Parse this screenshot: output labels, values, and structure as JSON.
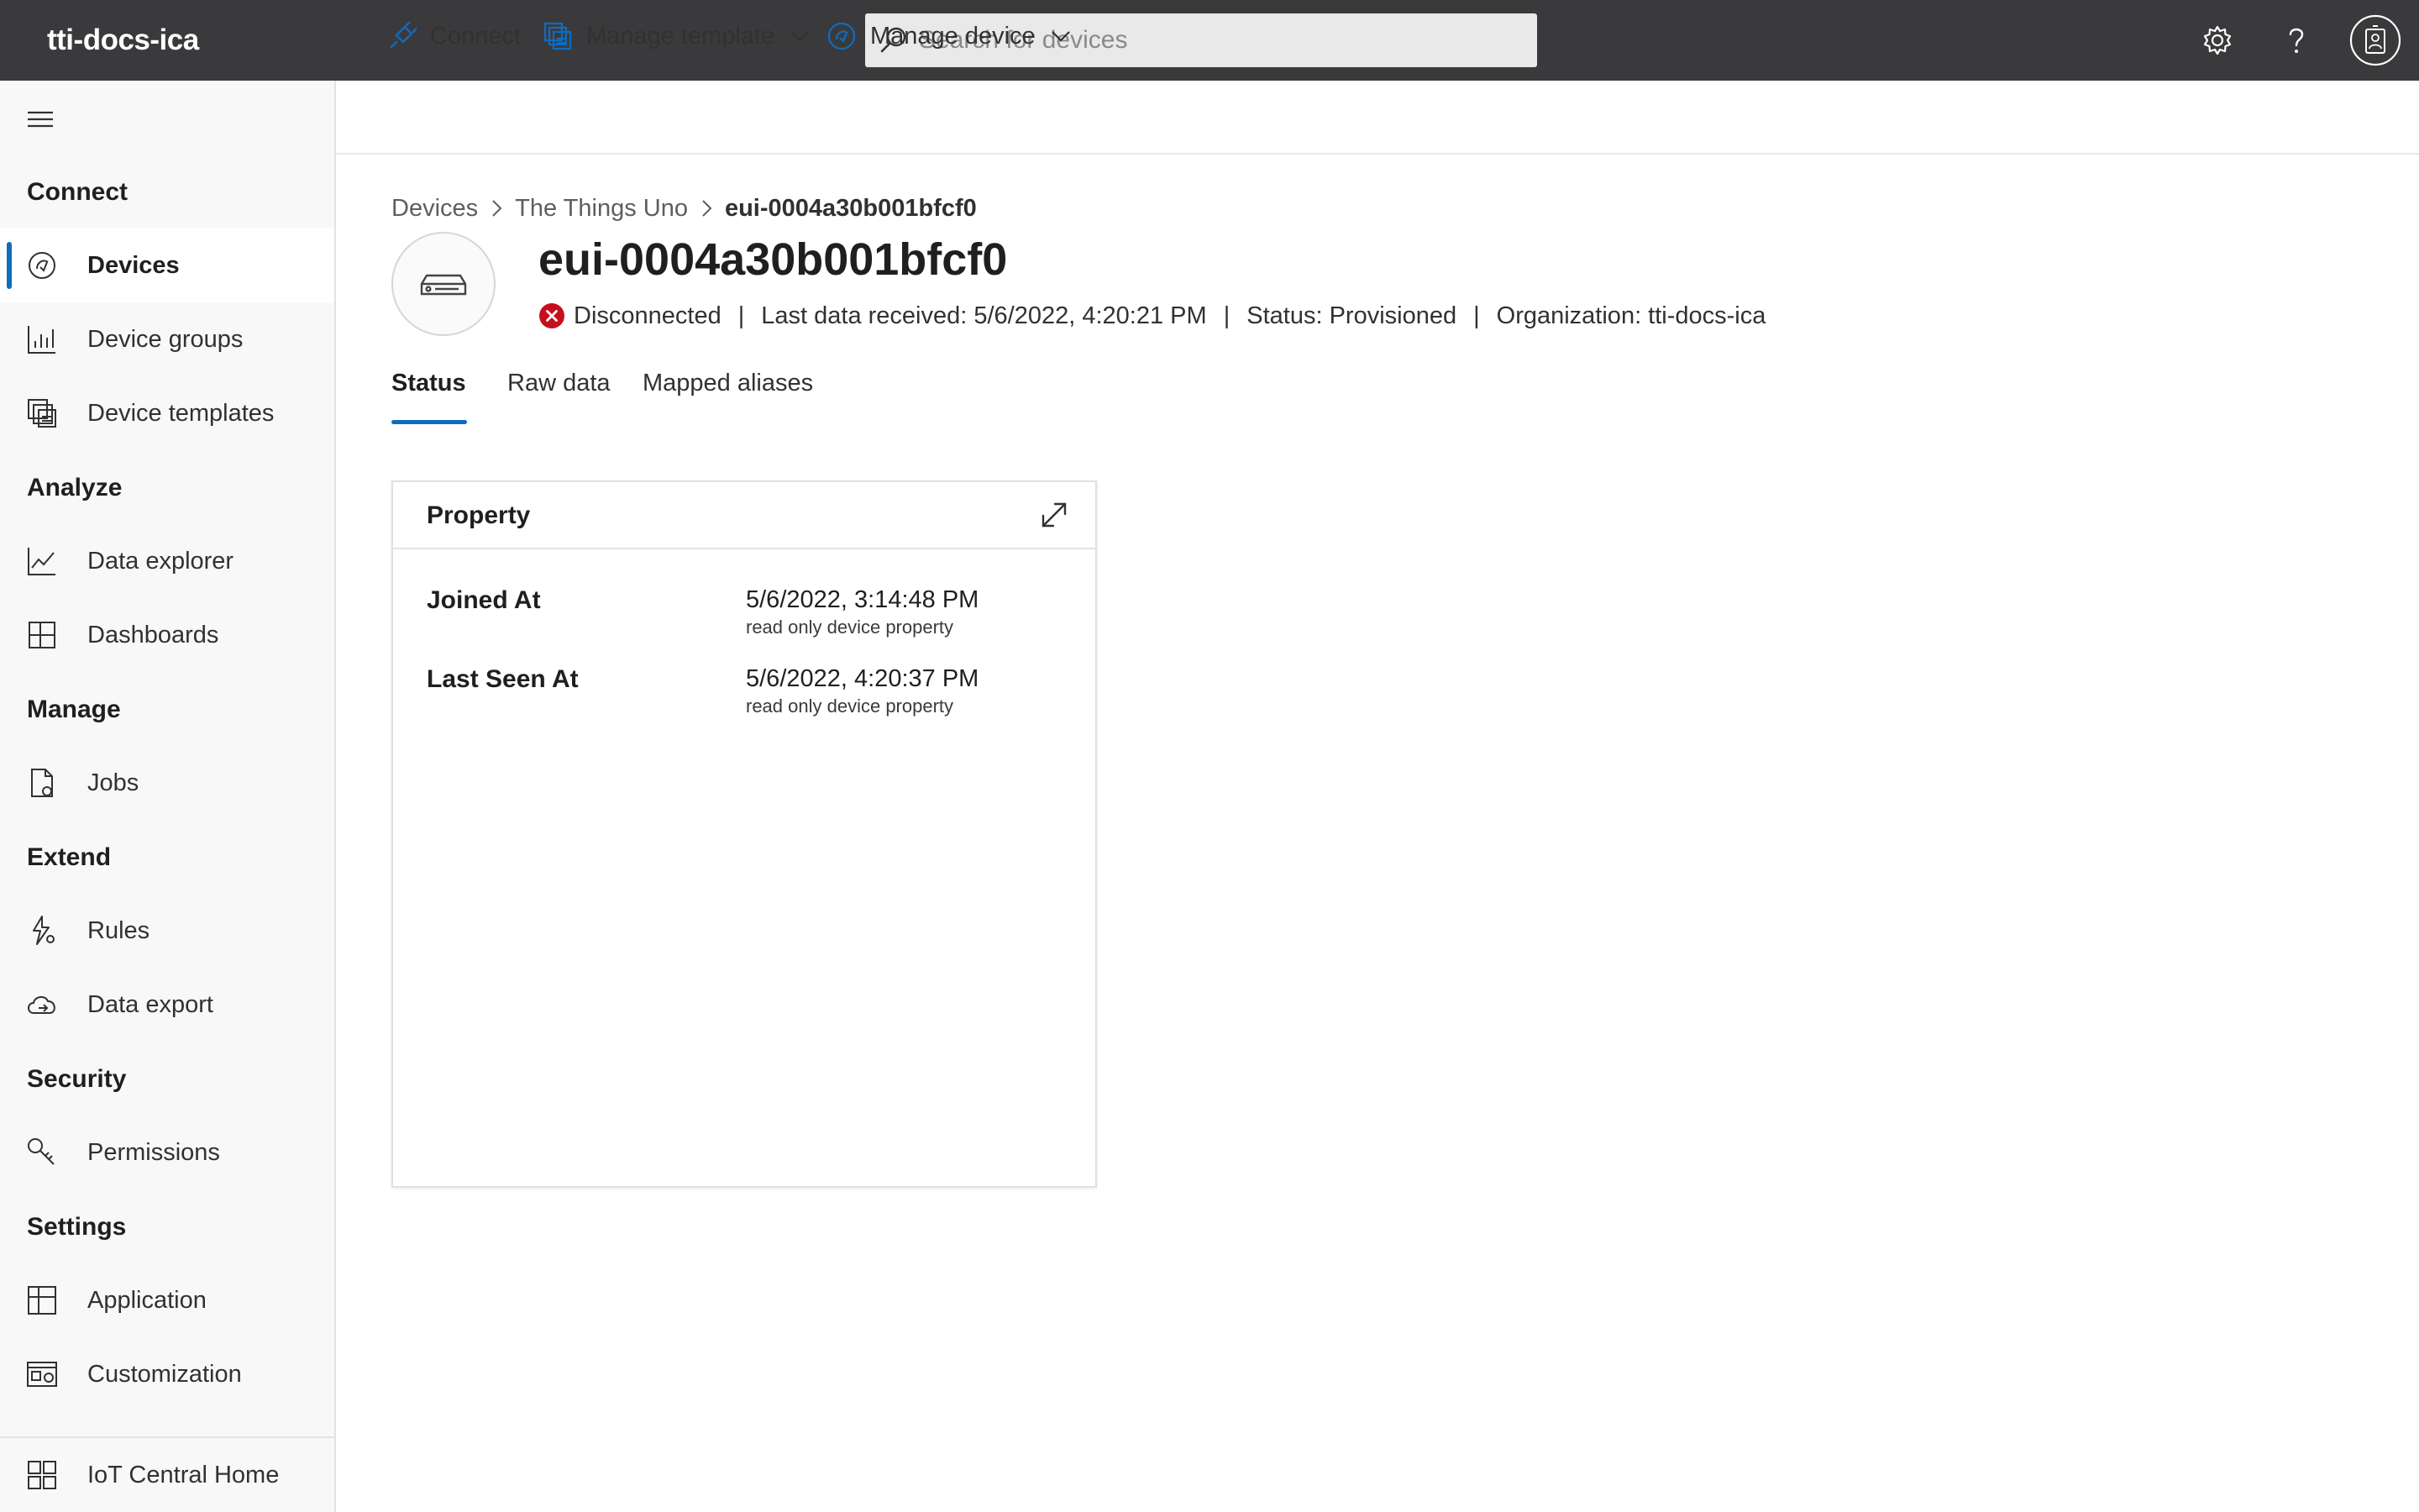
{
  "app": {
    "title": "tti-docs-ica"
  },
  "search": {
    "placeholder": "Search for devices",
    "value": ""
  },
  "sidebar": {
    "sections": [
      {
        "title": "Connect",
        "items": [
          {
            "label": "Devices",
            "icon": "devices-icon",
            "active": true
          },
          {
            "label": "Device groups",
            "icon": "device-groups-icon"
          },
          {
            "label": "Device templates",
            "icon": "device-templates-icon"
          }
        ]
      },
      {
        "title": "Analyze",
        "items": [
          {
            "label": "Data explorer",
            "icon": "data-explorer-icon"
          },
          {
            "label": "Dashboards",
            "icon": "dashboards-icon"
          }
        ]
      },
      {
        "title": "Manage",
        "items": [
          {
            "label": "Jobs",
            "icon": "jobs-icon"
          }
        ]
      },
      {
        "title": "Extend",
        "items": [
          {
            "label": "Rules",
            "icon": "rules-icon"
          },
          {
            "label": "Data export",
            "icon": "data-export-icon"
          }
        ]
      },
      {
        "title": "Security",
        "items": [
          {
            "label": "Permissions",
            "icon": "permissions-icon"
          }
        ]
      },
      {
        "title": "Settings",
        "items": [
          {
            "label": "Application",
            "icon": "application-icon"
          },
          {
            "label": "Customization",
            "icon": "customization-icon"
          }
        ]
      }
    ],
    "footer": {
      "label": "IoT Central Home",
      "icon": "iot-central-home-icon"
    }
  },
  "commandbar": {
    "connect": "Connect",
    "manage_template": "Manage template",
    "manage_device": "Manage device"
  },
  "breadcrumb": [
    "Devices",
    "The Things Uno",
    "eui-0004a30b001bfcf0"
  ],
  "device": {
    "name": "eui-0004a30b001bfcf0",
    "connection": "Disconnected",
    "last_data": "Last data received: 5/6/2022, 4:20:21 PM",
    "status": "Status: Provisioned",
    "organization": "Organization: tti-docs-ica",
    "separator": "|"
  },
  "tabs": [
    "Status",
    "Raw data",
    "Mapped aliases"
  ],
  "card": {
    "title": "Property",
    "rows": [
      {
        "label": "Joined At",
        "value": "5/6/2022, 3:14:48 PM",
        "note": "read only device property"
      },
      {
        "label": "Last Seen At",
        "value": "5/6/2022, 4:20:37 PM",
        "note": "read only device property"
      }
    ]
  },
  "colors": {
    "topbar": "#3a3a3d",
    "accent": "#0f6cbd",
    "error": "#c50f1f",
    "sidebar": "#f8f8f8"
  }
}
